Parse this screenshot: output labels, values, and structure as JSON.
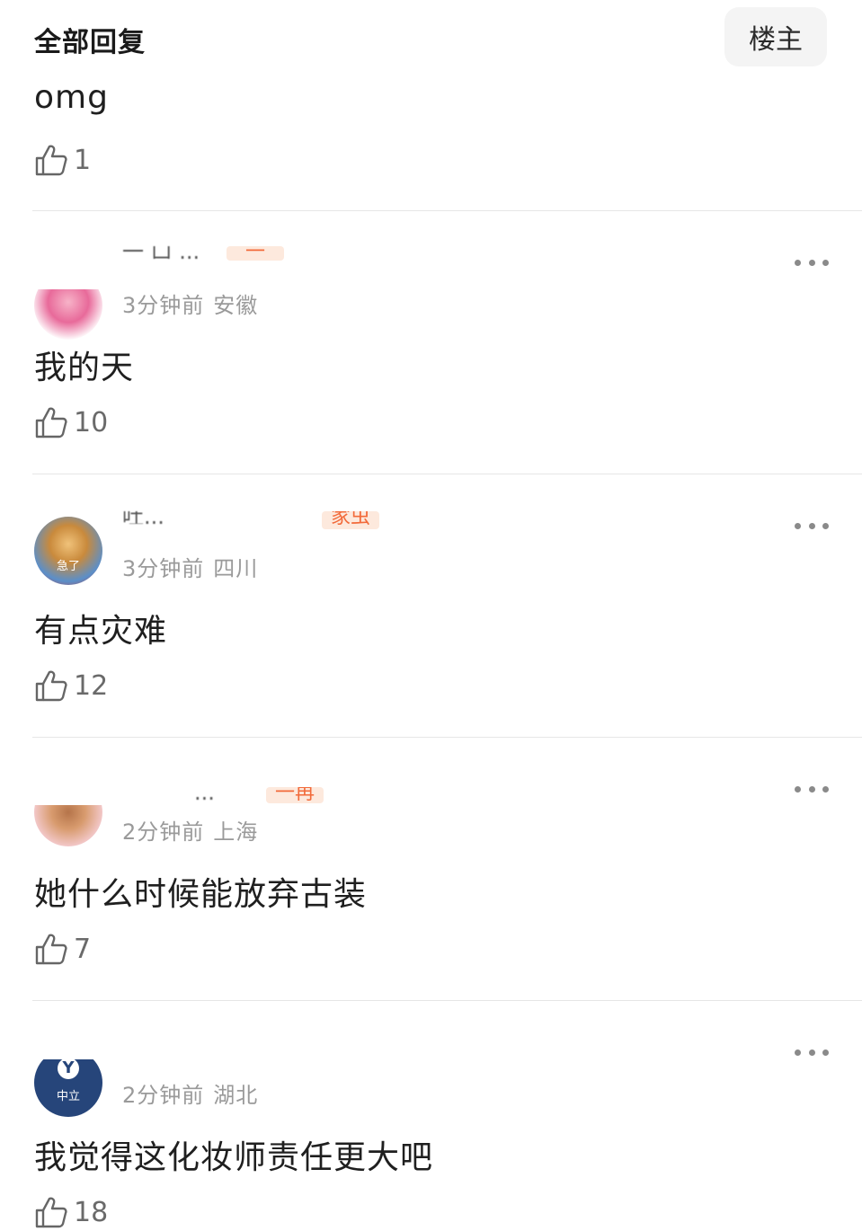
{
  "header": {
    "title": "全部回复",
    "op_filter_label": "楼主"
  },
  "comments": [
    {
      "content": "omg",
      "likes": "1"
    },
    {
      "username_partial": "一 口 ...",
      "badge": "一",
      "time": "3分钟前",
      "location": "安徽",
      "content": "我的天",
      "likes": "10"
    },
    {
      "username_partial": "吐...",
      "badge": "家虫",
      "avatar_text": "急了",
      "time": "3分钟前",
      "location": "四川",
      "content": "有点灾难",
      "likes": "12"
    },
    {
      "username_partial": "...",
      "badge": "一再",
      "time": "2分钟前",
      "location": "上海",
      "content": "她什么时候能放弃古装",
      "likes": "7"
    },
    {
      "username_partial": "",
      "avatar_text": "中立",
      "time": "2分钟前",
      "location": "湖北",
      "content": "我觉得这化妆师责任更大吧",
      "likes": "18"
    }
  ],
  "colors": {
    "meta_text": "#9a9a9a",
    "badge_bg": "#fde9dd",
    "badge_text": "#f26a3a",
    "divider": "#e6e6e6"
  },
  "icons": {
    "like": "thumbs-up-icon",
    "more": "more-dots-icon"
  }
}
